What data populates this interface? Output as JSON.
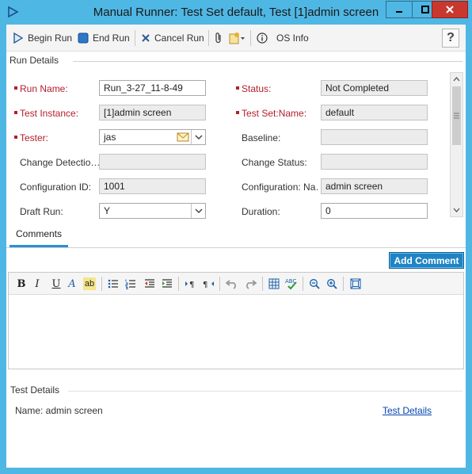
{
  "window": {
    "title": "Manual Runner: Test Set default, Test [1]admin screen",
    "minimize_glyph": "—",
    "restore_glyph": "□",
    "close_glyph": "✕"
  },
  "toolbar": {
    "begin_run": "Begin Run",
    "end_run": "End Run",
    "cancel_run": "Cancel Run",
    "os_info": "OS Info",
    "help": "?"
  },
  "run_details": {
    "section_title": "Run Details",
    "run_name": {
      "label": "Run Name:",
      "value": "Run_3-27_11-8-49"
    },
    "status": {
      "label": "Status:",
      "value": "Not Completed"
    },
    "test_instance": {
      "label": "Test Instance:",
      "value": "[1]admin screen"
    },
    "test_set_name": {
      "label": "Test Set:Name:",
      "value": "default"
    },
    "tester": {
      "label": "Tester:",
      "value": "jas"
    },
    "baseline": {
      "label": "Baseline:",
      "value": ""
    },
    "change_detection": {
      "label": "Change  Detectio…",
      "value": ""
    },
    "change_status": {
      "label": "Change Status:",
      "value": ""
    },
    "configuration_id": {
      "label": "Configuration ID:",
      "value": "1001"
    },
    "configuration_name": {
      "label": "Configuration:  Na…",
      "value": "admin screen"
    },
    "draft_run": {
      "label": "Draft Run:",
      "value": "Y"
    },
    "duration": {
      "label": "Duration:",
      "value": "0"
    }
  },
  "comments": {
    "tab_label": "Comments",
    "add_button": "Add Comment",
    "editor_buttons": [
      "B",
      "I",
      "U",
      "A",
      "ab"
    ]
  },
  "test_details": {
    "section_title": "Test Details",
    "name_text": "Name: admin screen",
    "link": "Test Details"
  },
  "colors": {
    "title_bar": "#4fb7e4",
    "required_label": "#b21e2c",
    "accent": "#1f84c4",
    "link": "#0645ad"
  }
}
